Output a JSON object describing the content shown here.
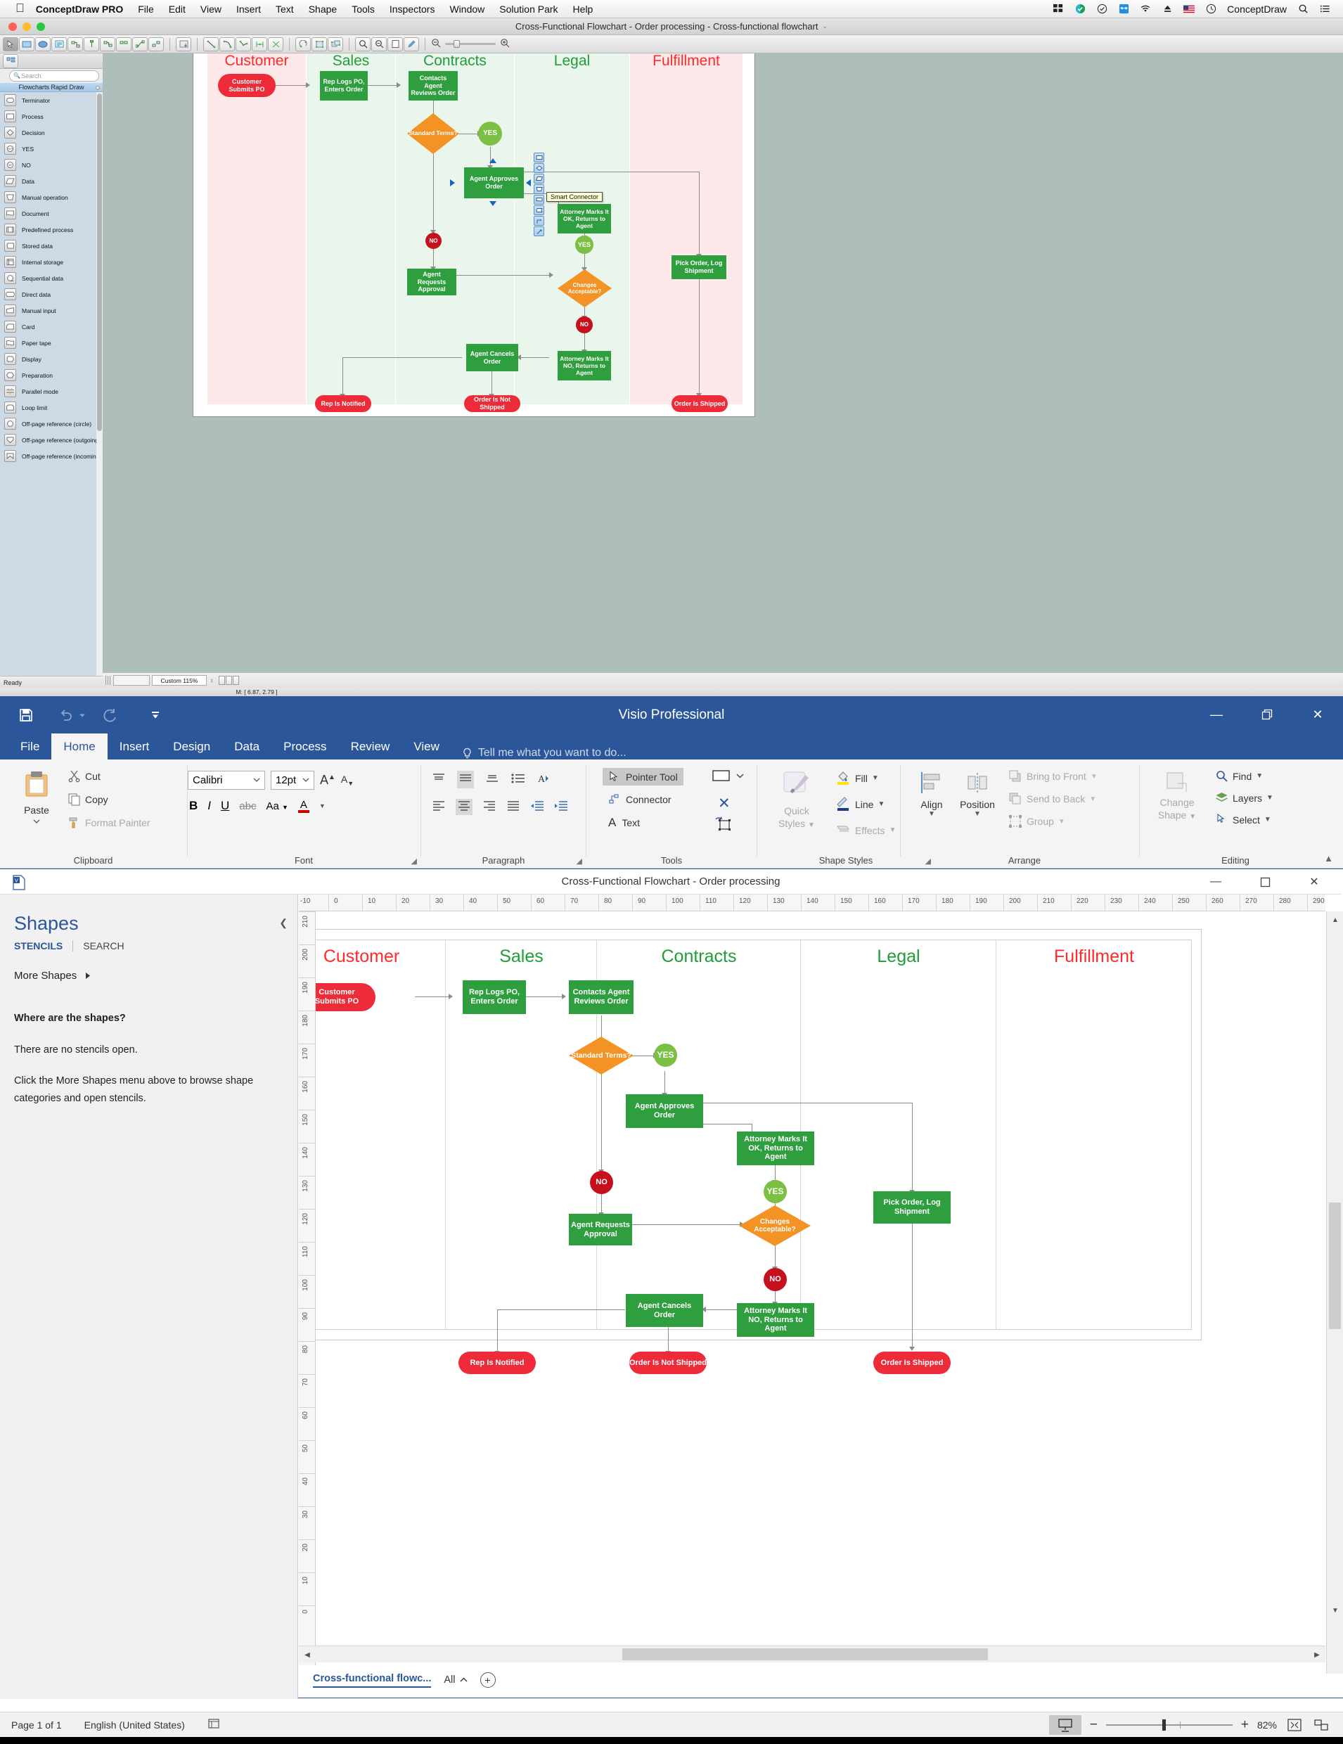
{
  "mac": {
    "apple_icon": "apple-logo",
    "app_name": "ConceptDraw PRO",
    "menus": [
      "File",
      "Edit",
      "View",
      "Insert",
      "Text",
      "Shape",
      "Tools",
      "Inspectors",
      "Window",
      "Solution Park",
      "Help"
    ],
    "status_icons": [
      "grid-icon",
      "conceptdraw-status-icon",
      "checkmark-circle-icon",
      "dropbox-icon",
      "wifi-icon",
      "eject-icon",
      "us-flag-icon",
      "clock-icon"
    ],
    "status_app_label": "ConceptDraw",
    "spotlight_icon": "search-icon",
    "notification_icon": "list-icon"
  },
  "conceptdraw": {
    "window_title": "Cross-Functional Flowchart - Order processing - Cross-functional flowchart",
    "title_caret": "⌄",
    "search_placeholder": "Search",
    "stencil_title": "Flowcharts Rapid Draw",
    "stencil_items": [
      {
        "label": "Terminator",
        "icon": "terminator-shape-icon"
      },
      {
        "label": "Process",
        "icon": "process-shape-icon"
      },
      {
        "label": "Decision",
        "icon": "decision-shape-icon"
      },
      {
        "label": "YES",
        "icon": "yes-shape-icon"
      },
      {
        "label": "NO",
        "icon": "no-shape-icon"
      },
      {
        "label": "Data",
        "icon": "data-shape-icon"
      },
      {
        "label": "Manual operation",
        "icon": "manual-operation-shape-icon"
      },
      {
        "label": "Document",
        "icon": "document-shape-icon"
      },
      {
        "label": "Predefined process",
        "icon": "predefined-process-shape-icon"
      },
      {
        "label": "Stored data",
        "icon": "stored-data-shape-icon"
      },
      {
        "label": "Internal storage",
        "icon": "internal-storage-shape-icon"
      },
      {
        "label": "Sequential data",
        "icon": "sequential-data-shape-icon"
      },
      {
        "label": "Direct data",
        "icon": "direct-data-shape-icon"
      },
      {
        "label": "Manual input",
        "icon": "manual-input-shape-icon"
      },
      {
        "label": "Card",
        "icon": "card-shape-icon"
      },
      {
        "label": "Paper tape",
        "icon": "paper-tape-shape-icon"
      },
      {
        "label": "Display",
        "icon": "display-shape-icon"
      },
      {
        "label": "Preparation",
        "icon": "preparation-shape-icon"
      },
      {
        "label": "Parallel mode",
        "icon": "parallel-mode-shape-icon"
      },
      {
        "label": "Loop limit",
        "icon": "loop-limit-shape-icon"
      },
      {
        "label": "Off-page reference (circle)",
        "icon": "offpage-circle-shape-icon"
      },
      {
        "label": "Off-page reference (outgoing)",
        "icon": "offpage-outgoing-shape-icon"
      },
      {
        "label": "Off-page reference (incoming)",
        "icon": "offpage-incoming-shape-icon"
      }
    ],
    "ready_label": "Ready",
    "zoom_value": "Custom 115%",
    "coordinates": "M: [ 6.87, 2.79 ]",
    "tooltip": "Smart Connector",
    "mini_palette": [
      "process-shape-icon",
      "decision-shape-icon",
      "data-shape-icon",
      "manual-operation-shape-icon",
      "document-shape-icon",
      "stored-data-shape-icon",
      "elbow-connector-icon",
      "smart-connector-icon"
    ]
  },
  "visio": {
    "app_title": "Visio Professional",
    "qat_icons": [
      "save-icon",
      "undo-icon",
      "undo-dropdown-icon",
      "redo-icon",
      "customize-qat-icon"
    ],
    "window_buttons": [
      "minimize-icon",
      "restore-icon",
      "close-icon"
    ],
    "tabs": [
      "File",
      "Home",
      "Insert",
      "Design",
      "Data",
      "Process",
      "Review",
      "View"
    ],
    "active_tab": "Home",
    "tell_me": "Tell me what you want to do...",
    "ribbon": {
      "clipboard": {
        "label": "Clipboard",
        "paste": "Paste",
        "cut": "Cut",
        "copy": "Copy",
        "format_painter": "Format Painter"
      },
      "font": {
        "label": "Font",
        "font_family": "Calibri",
        "font_size": "12pt",
        "buttons": [
          "grow-font-icon",
          "shrink-font-icon",
          "bold-icon",
          "italic-icon",
          "underline-icon",
          "strikethrough-icon",
          "character-spacing-icon",
          "font-color-icon"
        ]
      },
      "paragraph": {
        "label": "Paragraph",
        "buttons": [
          "align-top-icon",
          "align-middle-icon",
          "align-bottom-icon",
          "bullets-icon",
          "text-direction-icon",
          "align-left-icon",
          "align-center-icon",
          "align-right-icon",
          "justify-icon",
          "decrease-indent-icon",
          "increase-indent-icon"
        ]
      },
      "tools": {
        "label": "Tools",
        "pointer_tool": "Pointer Tool",
        "connector": "Connector",
        "text": "Text",
        "rect_tool_icon": "rectangle-tool-icon",
        "rect_dropdown_icon": "chevron-down-icon",
        "delete_icon": "delete-icon",
        "rotate_icon": "rotate-shape-icon"
      },
      "shape_styles": {
        "label": "Shape Styles",
        "quick_styles": "Quick\nStyles",
        "fill": "Fill",
        "line": "Line",
        "effects": "Effects"
      },
      "arrange": {
        "label": "Arrange",
        "bring_to_front": "Bring to Front",
        "send_to_back": "Send to Back",
        "align": "Align",
        "position": "Position",
        "group": "Group"
      },
      "editing": {
        "label": "Editing",
        "change_shape": "Change\nShape",
        "find": "Find",
        "layers": "Layers",
        "select": "Select"
      }
    },
    "doc_title": "Cross-Functional Flowchart - Order processing",
    "shapes_pane": {
      "header": "Shapes",
      "stencils_tab": "STENCILS",
      "search_tab": "SEARCH",
      "more_shapes": "More Shapes",
      "empty_title": "Where are the shapes?",
      "empty_line1": "There are no stencils open.",
      "empty_line2": "Click the More Shapes menu above to browse shape categories and open stencils.",
      "collapse_icon": "chevron-left-icon"
    },
    "ruler_top": [
      "-10",
      "0",
      "10",
      "20",
      "30",
      "40",
      "50",
      "60",
      "70",
      "80",
      "90",
      "100",
      "110",
      "120",
      "130",
      "140",
      "150",
      "160",
      "170",
      "180",
      "190",
      "200",
      "210",
      "220",
      "230",
      "240",
      "250",
      "260",
      "270",
      "280",
      "290"
    ],
    "ruler_left": [
      "210",
      "200",
      "190",
      "180",
      "170",
      "160",
      "150",
      "140",
      "130",
      "120",
      "110",
      "100",
      "90",
      "80",
      "70",
      "60",
      "50",
      "40",
      "30",
      "20",
      "10",
      "0"
    ],
    "page_tab": "Cross-functional flowc...",
    "all_label": "All",
    "add_page_icon": "plus-circle-icon",
    "status": {
      "page_of": "Page 1 of 1",
      "language": "English (United States)",
      "macros_icon": "macros-icon",
      "presentation_icon": "presentation-mode-icon",
      "zoom_out_icon": "minus-icon",
      "zoom_in_icon": "plus-icon",
      "zoom_level": "82%",
      "fit_page_icon": "fit-page-icon",
      "fit_width_icon": "fit-width-icon"
    }
  },
  "chart_data": {
    "type": "diagram",
    "diagram_kind": "cross-functional-flowchart",
    "title": "Order processing",
    "lanes": [
      {
        "name": "Customer",
        "color": "#ff2a2a",
        "fill": "#fde9ea"
      },
      {
        "name": "Sales",
        "color": "#1f9d37",
        "fill": "#eaf5ec"
      },
      {
        "name": "Contracts",
        "color": "#1f9d37",
        "fill": "#eaf5ec"
      },
      {
        "name": "Legal",
        "color": "#1f9d37",
        "fill": "#eaf5ec"
      },
      {
        "name": "Fulfillment",
        "color": "#ff2a2a",
        "fill": "#fde9ea"
      }
    ],
    "nodes": [
      {
        "id": "n1",
        "label": "Customer Submits PO",
        "shape": "terminator",
        "lane": "Customer",
        "color": "#ee2b39"
      },
      {
        "id": "n2",
        "label": "Rep Logs PO, Enters Order",
        "shape": "process",
        "lane": "Sales",
        "color": "#2f9e3f"
      },
      {
        "id": "n3",
        "label": "Contacts Agent Reviews Order",
        "shape": "process",
        "lane": "Contracts",
        "color": "#2f9e3f"
      },
      {
        "id": "n4",
        "label": "Standard Terms?",
        "shape": "decision",
        "lane": "Contracts",
        "color": "#f39325"
      },
      {
        "id": "n5",
        "label": "YES",
        "shape": "circle",
        "lane": "Contracts",
        "color": "#7cc043"
      },
      {
        "id": "n6",
        "label": "Agent Approves Order",
        "shape": "process",
        "lane": "Contracts",
        "color": "#2f9e3f"
      },
      {
        "id": "n7",
        "label": "NO",
        "shape": "circle",
        "lane": "Contracts",
        "color": "#c6101e"
      },
      {
        "id": "n8",
        "label": "Agent Requests Approval",
        "shape": "process",
        "lane": "Contracts",
        "color": "#2f9e3f"
      },
      {
        "id": "n9",
        "label": "Attorney Marks It OK, Returns to Agent",
        "shape": "process",
        "lane": "Legal",
        "color": "#2f9e3f"
      },
      {
        "id": "n10",
        "label": "YES",
        "shape": "circle",
        "lane": "Legal",
        "color": "#7cc043"
      },
      {
        "id": "n11",
        "label": "Changes Acceptable?",
        "shape": "decision",
        "lane": "Legal",
        "color": "#f39325"
      },
      {
        "id": "n12",
        "label": "NO",
        "shape": "circle",
        "lane": "Legal",
        "color": "#c6101e"
      },
      {
        "id": "n13",
        "label": "Attorney Marks It NO, Returns to Agent",
        "shape": "process",
        "lane": "Legal",
        "color": "#2f9e3f"
      },
      {
        "id": "n14",
        "label": "Agent Cancels Order",
        "shape": "process",
        "lane": "Contracts",
        "color": "#2f9e3f"
      },
      {
        "id": "n15",
        "label": "Pick Order, Log Shipment",
        "shape": "process",
        "lane": "Fulfillment",
        "color": "#2f9e3f"
      },
      {
        "id": "n16",
        "label": "Rep Is Notified",
        "shape": "terminator",
        "lane": "Sales",
        "color": "#ee2b39"
      },
      {
        "id": "n17",
        "label": "Order Is Not Shipped",
        "shape": "terminator",
        "lane": "Contracts",
        "color": "#ee2b39"
      },
      {
        "id": "n18",
        "label": "Order Is Shipped",
        "shape": "terminator",
        "lane": "Fulfillment",
        "color": "#ee2b39"
      }
    ],
    "edges": [
      {
        "from": "n1",
        "to": "n2"
      },
      {
        "from": "n2",
        "to": "n3"
      },
      {
        "from": "n3",
        "to": "n4"
      },
      {
        "from": "n4",
        "to": "n5"
      },
      {
        "from": "n5",
        "to": "n6"
      },
      {
        "from": "n4",
        "to": "n7"
      },
      {
        "from": "n7",
        "to": "n8"
      },
      {
        "from": "n8",
        "to": "n11"
      },
      {
        "from": "n9",
        "to": "n10"
      },
      {
        "from": "n10",
        "to": "n11"
      },
      {
        "from": "n11",
        "to": "n12"
      },
      {
        "from": "n12",
        "to": "n13"
      },
      {
        "from": "n13",
        "to": "n14"
      },
      {
        "from": "n14",
        "to": "n17"
      },
      {
        "from": "n14",
        "to": "n16"
      },
      {
        "from": "n6",
        "to": "n15"
      },
      {
        "from": "n15",
        "to": "n18"
      },
      {
        "from": "n6",
        "to": "n9"
      }
    ]
  }
}
